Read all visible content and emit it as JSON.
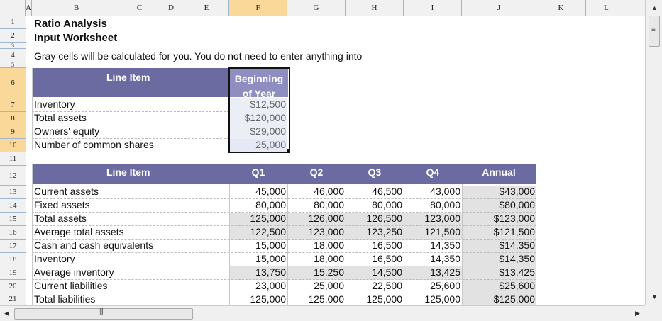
{
  "columns": [
    "A",
    "B",
    "C",
    "D",
    "E",
    "F",
    "G",
    "H",
    "I",
    "J",
    "K",
    "L"
  ],
  "rows": [
    "1",
    "2",
    "3",
    "4",
    "5",
    "6",
    "7",
    "8",
    "9",
    "10",
    "11",
    "12",
    "13",
    "14",
    "15",
    "16",
    "17",
    "18",
    "19",
    "20",
    "21"
  ],
  "sheet": {
    "title1": "Ratio Analysis",
    "title2": "Input Worksheet",
    "note": "Gray cells will be calculated for you. You do not need to enter anything into"
  },
  "table1": {
    "header_item": "Line Item",
    "header_value": "Beginning of Year",
    "rows": [
      {
        "label": "Inventory",
        "value": "$12,500"
      },
      {
        "label": "Total assets",
        "value": "$120,000"
      },
      {
        "label": "Owners' equity",
        "value": "$29,000"
      },
      {
        "label": "Number of common shares",
        "value": "25,000"
      }
    ]
  },
  "table2": {
    "headers": [
      "Line Item",
      "Q1",
      "Q2",
      "Q3",
      "Q4",
      "Annual"
    ],
    "rows": [
      {
        "label": "Current assets",
        "q1": "45,000",
        "q2": "46,000",
        "q3": "46,500",
        "q4": "43,000",
        "annual": "$43,000",
        "calc": false
      },
      {
        "label": "Fixed assets",
        "q1": "80,000",
        "q2": "80,000",
        "q3": "80,000",
        "q4": "80,000",
        "annual": "$80,000",
        "calc": false
      },
      {
        "label": "Total assets",
        "q1": "125,000",
        "q2": "126,000",
        "q3": "126,500",
        "q4": "123,000",
        "annual": "$123,000",
        "calc": true
      },
      {
        "label": "Average total assets",
        "q1": "122,500",
        "q2": "123,000",
        "q3": "123,250",
        "q4": "121,500",
        "annual": "$121,500",
        "calc": true
      },
      {
        "label": "Cash and cash equivalents",
        "q1": "15,000",
        "q2": "18,000",
        "q3": "16,500",
        "q4": "14,350",
        "annual": "$14,350",
        "calc": false
      },
      {
        "label": "Inventory",
        "q1": "15,000",
        "q2": "18,000",
        "q3": "16,500",
        "q4": "14,350",
        "annual": "$14,350",
        "calc": false
      },
      {
        "label": "Average inventory",
        "q1": "13,750",
        "q2": "15,250",
        "q3": "14,500",
        "q4": "13,425",
        "annual": "$13,425",
        "calc": true
      },
      {
        "label": "Current liabilities",
        "q1": "23,000",
        "q2": "25,000",
        "q3": "22,500",
        "q4": "25,600",
        "annual": "$25,600",
        "calc": false
      },
      {
        "label": "Total liabilities",
        "q1": "125,000",
        "q2": "125,000",
        "q3": "125,000",
        "q4": "125,000",
        "annual": "$125,000",
        "calc": false
      }
    ]
  },
  "colors": {
    "header_band": "#6b6ba1",
    "calc_gray": "#e2e2e2",
    "selected_header": "#f9d899"
  },
  "icons": {
    "scroll_up": "triangle-up-icon",
    "scroll_down": "triangle-down-icon",
    "scroll_left": "triangle-left-icon",
    "scroll_right": "triangle-right-icon",
    "grip": "grip-icon"
  }
}
